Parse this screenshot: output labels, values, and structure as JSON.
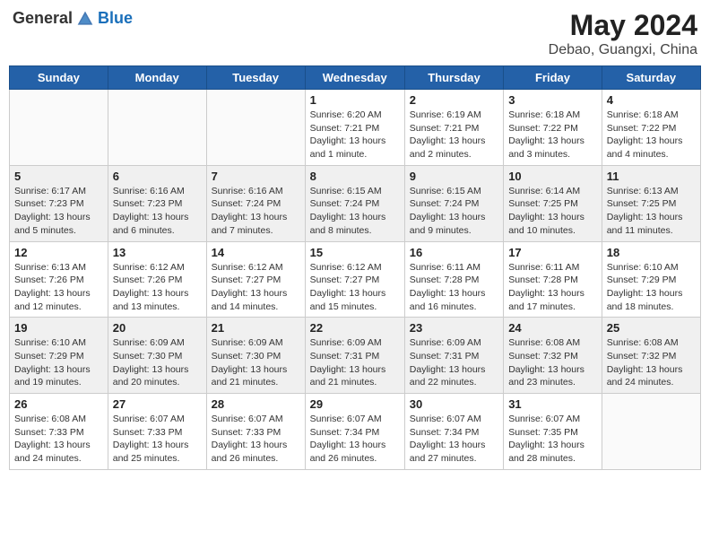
{
  "header": {
    "logo_general": "General",
    "logo_blue": "Blue",
    "month_year": "May 2024",
    "location": "Debao, Guangxi, China"
  },
  "weekdays": [
    "Sunday",
    "Monday",
    "Tuesday",
    "Wednesday",
    "Thursday",
    "Friday",
    "Saturday"
  ],
  "rows": [
    {
      "cells": [
        {
          "day": "",
          "info": ""
        },
        {
          "day": "",
          "info": ""
        },
        {
          "day": "",
          "info": ""
        },
        {
          "day": "1",
          "info": "Sunrise: 6:20 AM\nSunset: 7:21 PM\nDaylight: 13 hours\nand 1 minute."
        },
        {
          "day": "2",
          "info": "Sunrise: 6:19 AM\nSunset: 7:21 PM\nDaylight: 13 hours\nand 2 minutes."
        },
        {
          "day": "3",
          "info": "Sunrise: 6:18 AM\nSunset: 7:22 PM\nDaylight: 13 hours\nand 3 minutes."
        },
        {
          "day": "4",
          "info": "Sunrise: 6:18 AM\nSunset: 7:22 PM\nDaylight: 13 hours\nand 4 minutes."
        }
      ]
    },
    {
      "cells": [
        {
          "day": "5",
          "info": "Sunrise: 6:17 AM\nSunset: 7:23 PM\nDaylight: 13 hours\nand 5 minutes."
        },
        {
          "day": "6",
          "info": "Sunrise: 6:16 AM\nSunset: 7:23 PM\nDaylight: 13 hours\nand 6 minutes."
        },
        {
          "day": "7",
          "info": "Sunrise: 6:16 AM\nSunset: 7:24 PM\nDaylight: 13 hours\nand 7 minutes."
        },
        {
          "day": "8",
          "info": "Sunrise: 6:15 AM\nSunset: 7:24 PM\nDaylight: 13 hours\nand 8 minutes."
        },
        {
          "day": "9",
          "info": "Sunrise: 6:15 AM\nSunset: 7:24 PM\nDaylight: 13 hours\nand 9 minutes."
        },
        {
          "day": "10",
          "info": "Sunrise: 6:14 AM\nSunset: 7:25 PM\nDaylight: 13 hours\nand 10 minutes."
        },
        {
          "day": "11",
          "info": "Sunrise: 6:13 AM\nSunset: 7:25 PM\nDaylight: 13 hours\nand 11 minutes."
        }
      ]
    },
    {
      "cells": [
        {
          "day": "12",
          "info": "Sunrise: 6:13 AM\nSunset: 7:26 PM\nDaylight: 13 hours\nand 12 minutes."
        },
        {
          "day": "13",
          "info": "Sunrise: 6:12 AM\nSunset: 7:26 PM\nDaylight: 13 hours\nand 13 minutes."
        },
        {
          "day": "14",
          "info": "Sunrise: 6:12 AM\nSunset: 7:27 PM\nDaylight: 13 hours\nand 14 minutes."
        },
        {
          "day": "15",
          "info": "Sunrise: 6:12 AM\nSunset: 7:27 PM\nDaylight: 13 hours\nand 15 minutes."
        },
        {
          "day": "16",
          "info": "Sunrise: 6:11 AM\nSunset: 7:28 PM\nDaylight: 13 hours\nand 16 minutes."
        },
        {
          "day": "17",
          "info": "Sunrise: 6:11 AM\nSunset: 7:28 PM\nDaylight: 13 hours\nand 17 minutes."
        },
        {
          "day": "18",
          "info": "Sunrise: 6:10 AM\nSunset: 7:29 PM\nDaylight: 13 hours\nand 18 minutes."
        }
      ]
    },
    {
      "cells": [
        {
          "day": "19",
          "info": "Sunrise: 6:10 AM\nSunset: 7:29 PM\nDaylight: 13 hours\nand 19 minutes."
        },
        {
          "day": "20",
          "info": "Sunrise: 6:09 AM\nSunset: 7:30 PM\nDaylight: 13 hours\nand 20 minutes."
        },
        {
          "day": "21",
          "info": "Sunrise: 6:09 AM\nSunset: 7:30 PM\nDaylight: 13 hours\nand 21 minutes."
        },
        {
          "day": "22",
          "info": "Sunrise: 6:09 AM\nSunset: 7:31 PM\nDaylight: 13 hours\nand 21 minutes."
        },
        {
          "day": "23",
          "info": "Sunrise: 6:09 AM\nSunset: 7:31 PM\nDaylight: 13 hours\nand 22 minutes."
        },
        {
          "day": "24",
          "info": "Sunrise: 6:08 AM\nSunset: 7:32 PM\nDaylight: 13 hours\nand 23 minutes."
        },
        {
          "day": "25",
          "info": "Sunrise: 6:08 AM\nSunset: 7:32 PM\nDaylight: 13 hours\nand 24 minutes."
        }
      ]
    },
    {
      "cells": [
        {
          "day": "26",
          "info": "Sunrise: 6:08 AM\nSunset: 7:33 PM\nDaylight: 13 hours\nand 24 minutes."
        },
        {
          "day": "27",
          "info": "Sunrise: 6:07 AM\nSunset: 7:33 PM\nDaylight: 13 hours\nand 25 minutes."
        },
        {
          "day": "28",
          "info": "Sunrise: 6:07 AM\nSunset: 7:33 PM\nDaylight: 13 hours\nand 26 minutes."
        },
        {
          "day": "29",
          "info": "Sunrise: 6:07 AM\nSunset: 7:34 PM\nDaylight: 13 hours\nand 26 minutes."
        },
        {
          "day": "30",
          "info": "Sunrise: 6:07 AM\nSunset: 7:34 PM\nDaylight: 13 hours\nand 27 minutes."
        },
        {
          "day": "31",
          "info": "Sunrise: 6:07 AM\nSunset: 7:35 PM\nDaylight: 13 hours\nand 28 minutes."
        },
        {
          "day": "",
          "info": ""
        }
      ]
    }
  ]
}
